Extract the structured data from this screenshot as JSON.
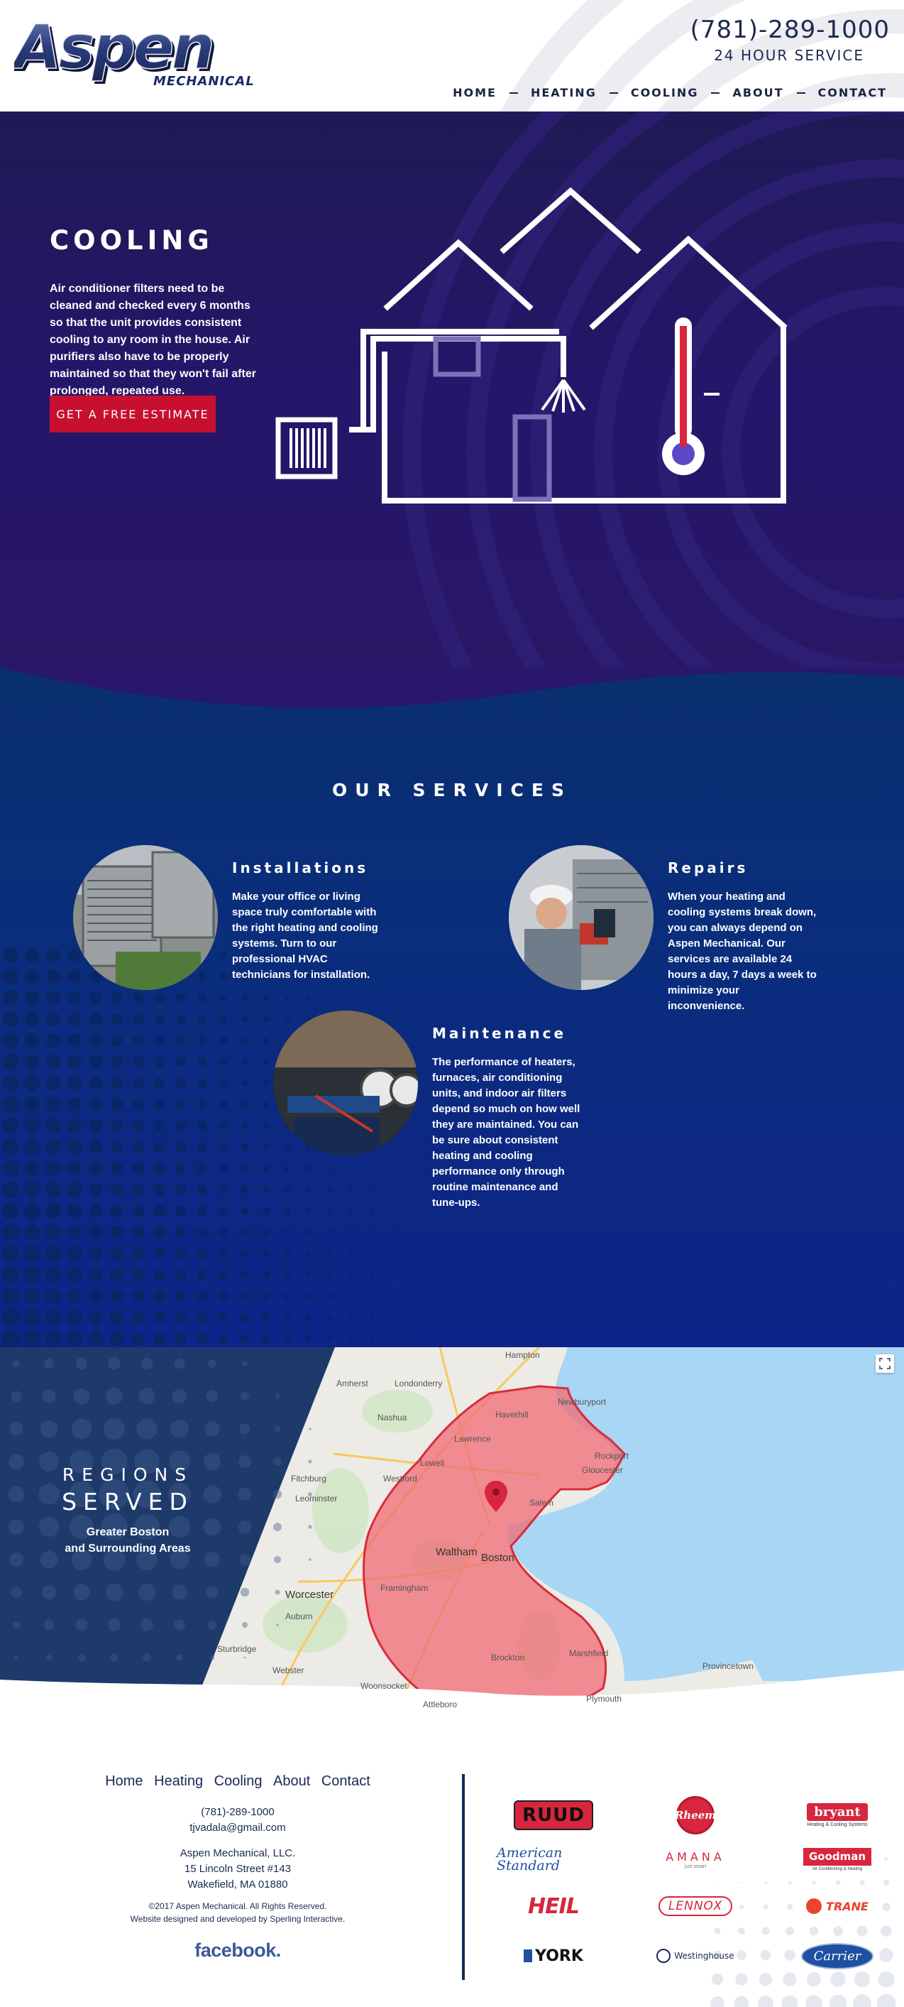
{
  "header": {
    "logo_text": "Aspen",
    "logo_sub": "MECHANICAL",
    "phone": "(781)-289-1000",
    "service_hours": "24 HOUR SERVICE",
    "nav": [
      "HOME",
      "HEATING",
      "COOLING",
      "ABOUT",
      "CONTACT"
    ]
  },
  "hero": {
    "title": "COOLING",
    "text": "Air conditioner filters need to be cleaned and checked every 6 months so that the unit provides consistent cooling to any room in the house. Air purifiers also have to be properly maintained so that they won't fail after prolonged, repeated use.",
    "cta": "GET A FREE ESTIMATE",
    "illustration_icon": "house-thermostat-ac-icon"
  },
  "services": {
    "title": "OUR SERVICES",
    "items": [
      {
        "title": "Installations",
        "text": "Make your office or living space truly comfortable with the right heating and cooling systems. Turn to our professional HVAC technicians for installation.",
        "photo": "ac-units-photo"
      },
      {
        "title": "Repairs",
        "text": "When your heating and cooling systems break down, you can always depend on Aspen Mechanical. Our services are available 24 hours a day, 7 days a week to minimize your inconvenience.",
        "photo": "technician-repair-photo"
      },
      {
        "title": "Maintenance",
        "text": "The performance of heaters, furnaces, air conditioning units, and indoor air filters depend so much on how well they are maintained. You can be sure about consistent heating and cooling performance only through routine maintenance and tune-ups.",
        "photo": "gauges-maintenance-photo"
      }
    ]
  },
  "regions": {
    "line1": "REGIONS",
    "line2": "SERVED",
    "line3": "Greater Boston",
    "line4": "and Surrounding Areas",
    "map_labels": {
      "hampton": "Hampton",
      "amherst": "Amherst",
      "londonderry": "Londonderry",
      "haverhill": "Haverhill",
      "newburyport": "Newburyport",
      "nashua": "Nashua",
      "lawrence": "Lawrence",
      "lowell": "Lowell",
      "rockport": "Rockport",
      "gloucester": "Gloucester",
      "fitchburg": "Fitchburg",
      "westford": "Westford",
      "leominster": "Leominster",
      "salem": "Salem",
      "waltham": "Waltham",
      "boston": "Boston",
      "framingham": "Framingham",
      "worcester": "Worcester",
      "auburn": "Auburn",
      "brockton": "Brockton",
      "marshfield": "Marshfield",
      "sturbridge": "Sturbridge",
      "webster": "Webster",
      "woonsocket": "Woonsocket",
      "attleboro": "Attleboro",
      "plymouth": "Plymouth",
      "provincetown": "Provincetown"
    }
  },
  "footer": {
    "nav": [
      "Home",
      "Heating",
      "Cooling",
      "About",
      "Contact"
    ],
    "phone": "(781)-289-1000",
    "email": "tjvadala@gmail.com",
    "company": "Aspen Mechanical, LLC.",
    "street": "15 Lincoln Street #143",
    "city": "Wakefield, MA 01880",
    "copyright": "©2017 Aspen Mechanical. All Rights Reserved.",
    "credit": "Website designed and developed by Sperling Interactive.",
    "facebook": "facebook.",
    "brands": [
      "RUUD",
      "Rheem",
      "bryant",
      "American Standard",
      "AMANA",
      "Goodman",
      "HEIL",
      "LENNOX",
      "TRANE",
      "YORK",
      "Westinghouse",
      "Carrier"
    ]
  },
  "colors": {
    "header_text": "#1d2a4f",
    "hero_bg": "#24166a",
    "cta_red": "#c7102f",
    "services_bg": "#0a2d7c",
    "coverage_red": "#f06b74",
    "footer_text": "#1a2a52"
  }
}
